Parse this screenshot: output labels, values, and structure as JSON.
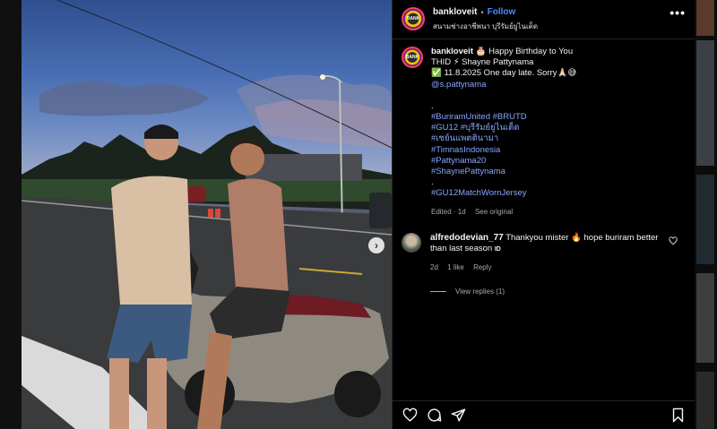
{
  "post": {
    "username": "bankloveit",
    "follow_label": "Follow",
    "location": "สนามช่างอาชีพนา บุรีรัมย์ยูไนเต็ด",
    "more_label": "•••",
    "avatar_text": "BANK"
  },
  "caption": {
    "username": "bankloveit",
    "line1": "🎂 Happy Birthday to You",
    "line2": "THID ⚡ Shayne Pattynama",
    "line3": "✅ 11.8.2025 One day late. Sorry🙏🏻😅",
    "mention": "@s.pattynama",
    "dot1": ".",
    "hashtags": [
      "#BuriramUnited #BRUTD",
      "#GU12 #บุรีรัมย์ยูไนเต็ด",
      "#เซย์นแพตตินามา",
      "#TimnasIndonesia",
      "#Pattynama20",
      "#ShaynePattynama"
    ],
    "dot2": ".",
    "last_tag": "#GU12MatchWornJersey",
    "edited": "Edited · 1d",
    "see_original": "See original"
  },
  "comment": {
    "username": "alfredodevian_77",
    "text": "Thankyou mister 🔥 hope buriram better than last season ",
    "flag": "ID",
    "age": "2d",
    "likes": "1 like",
    "reply": "Reply",
    "view_replies": "View replies (1)"
  },
  "carousel": {
    "next_glyph": "›"
  },
  "colors": {
    "link": "#8aa6ff",
    "follow": "#4a8cff",
    "panel_bg": "#000000"
  }
}
